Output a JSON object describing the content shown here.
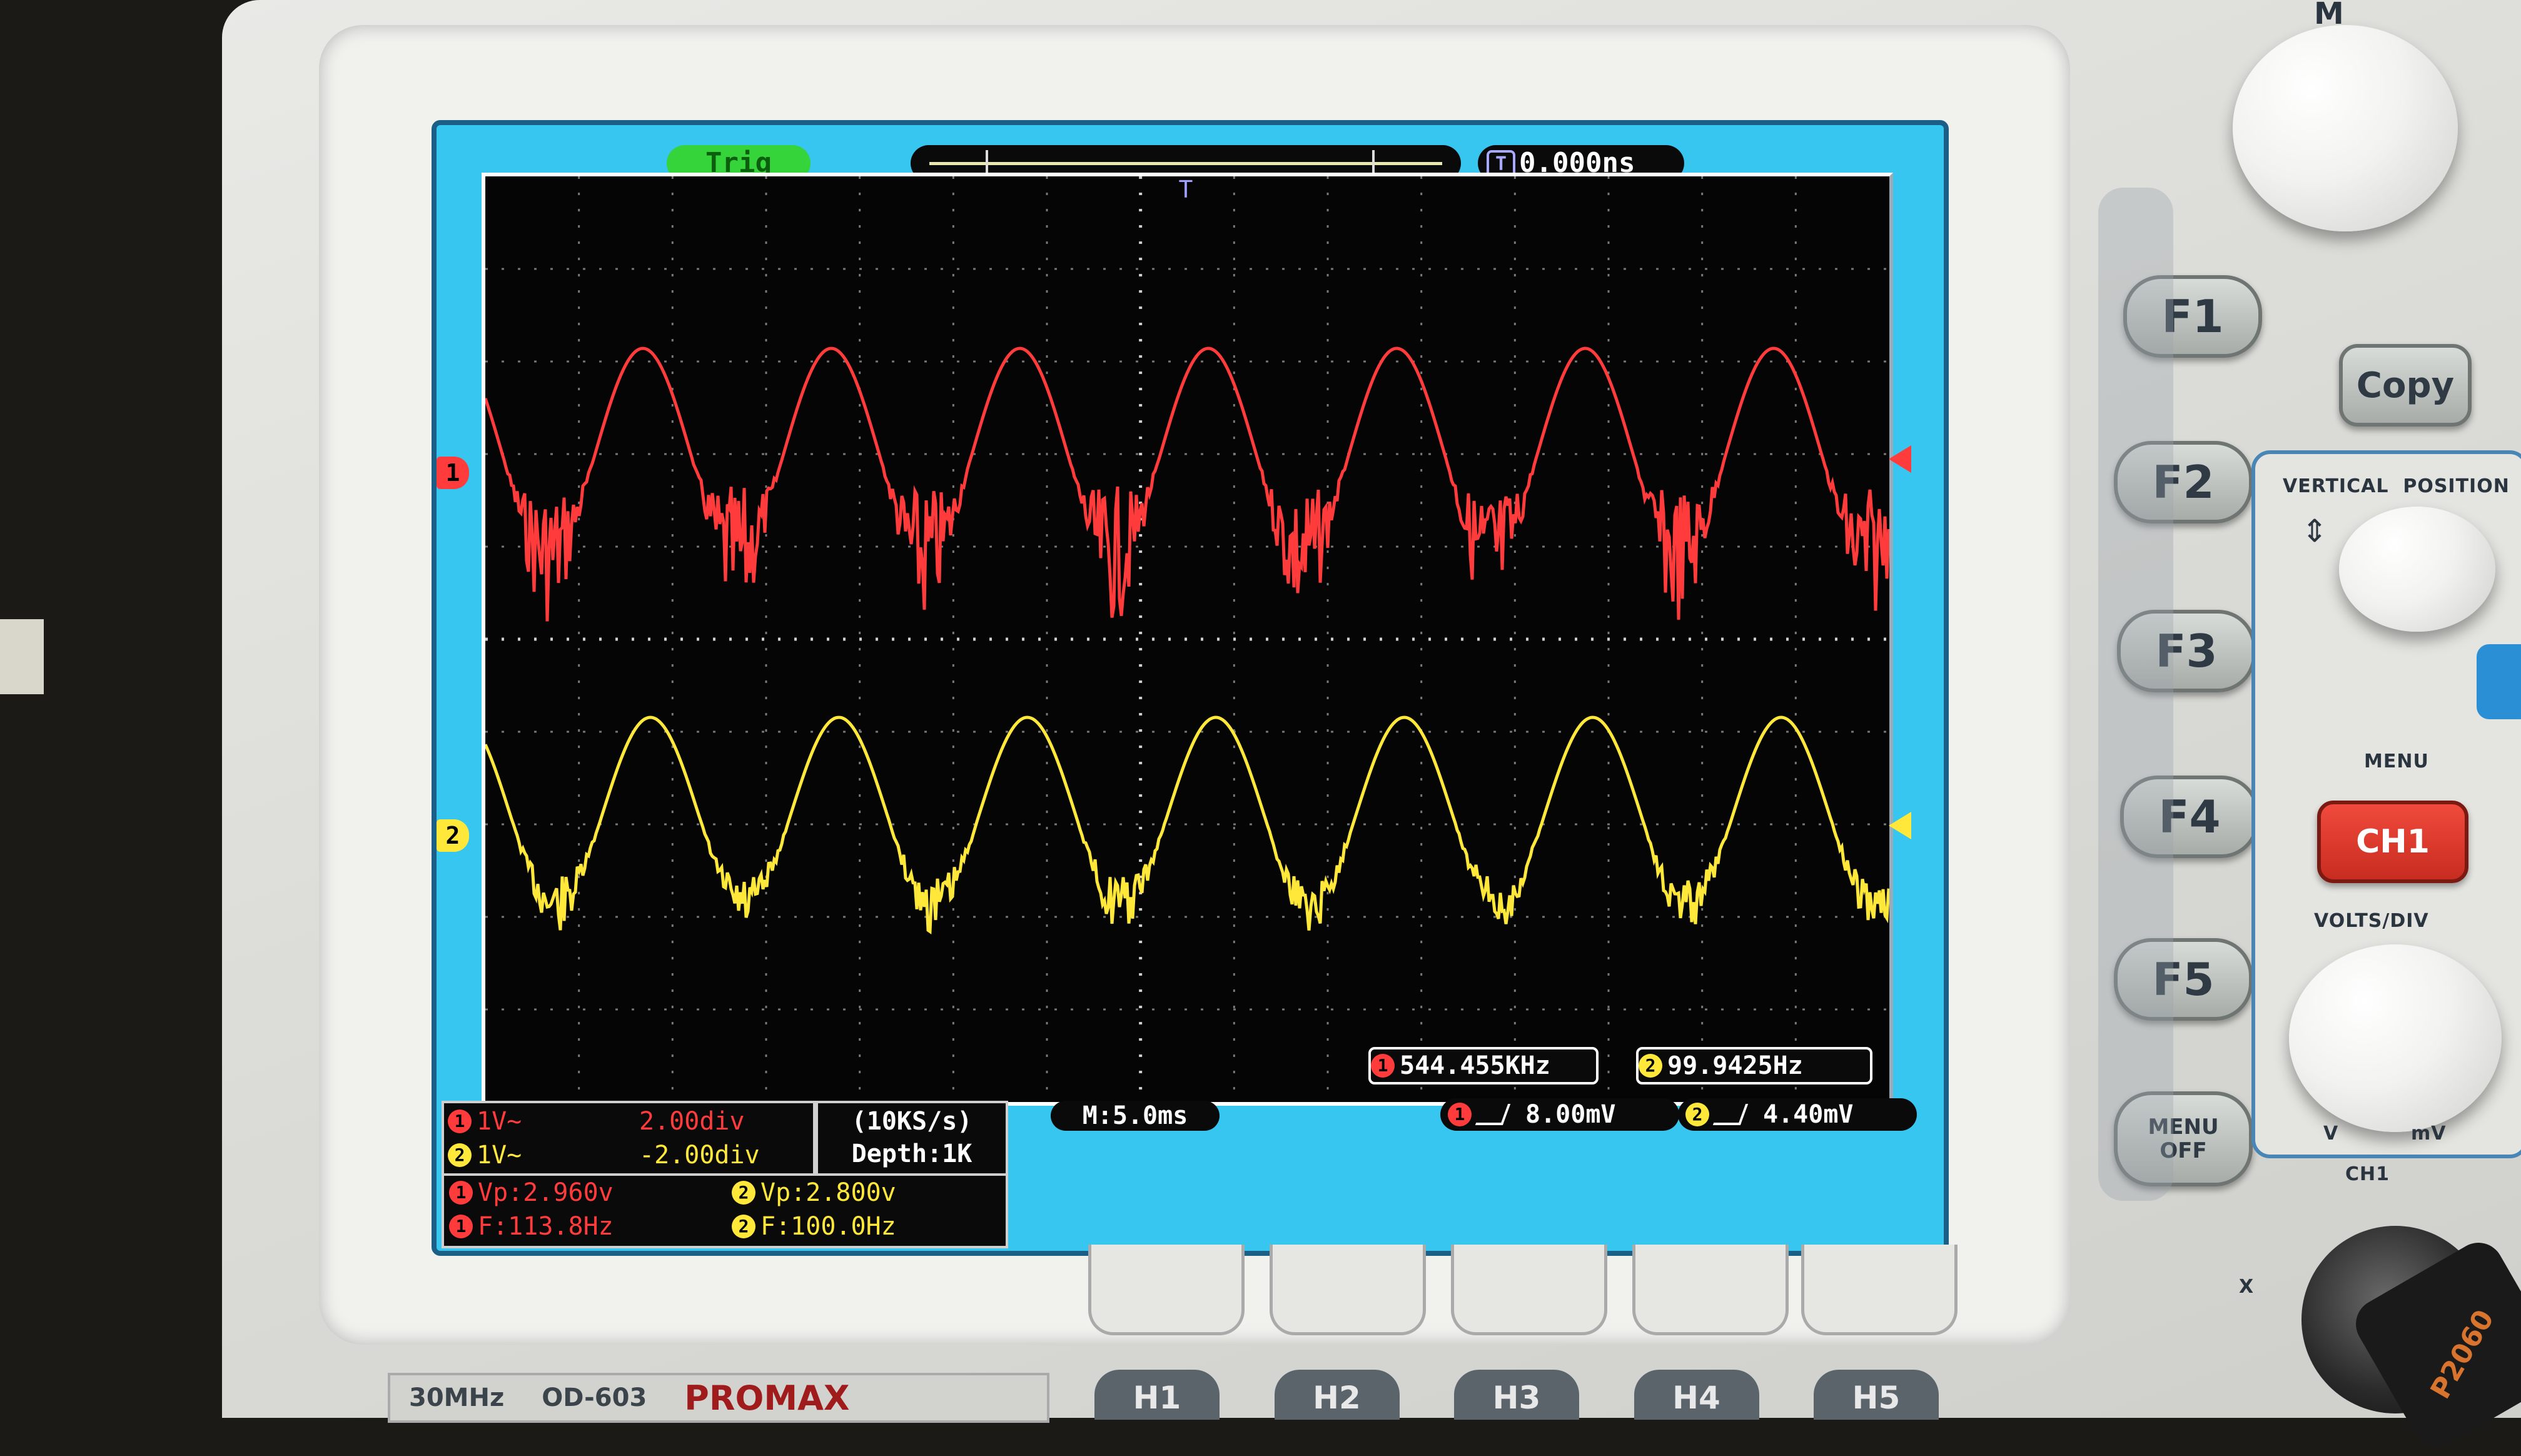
{
  "status_bar": {
    "trig": "Trig",
    "trigger_marker": "T",
    "time_offset": "0.000ns"
  },
  "channels": [
    {
      "id": "1",
      "color": "#ff3b3b",
      "coupling": "1V~",
      "position": "2.00div",
      "vp": "Vp:2.960v",
      "freq": "F:113.8Hz",
      "counter": "544.455KHz",
      "trigger_level": "8.00mV"
    },
    {
      "id": "2",
      "color": "#ffe83a",
      "coupling": "1V~",
      "position": "-2.00div",
      "vp": "Vp:2.800v",
      "freq": "F:100.0Hz",
      "counter": "99.9425Hz",
      "trigger_level": "4.40mV"
    }
  ],
  "acquisition": {
    "rate": "(10KS/s)",
    "depth": "Depth:1K",
    "timebase": "M:5.0ms"
  },
  "side_buttons": [
    "F1",
    "F2",
    "F3",
    "F4",
    "F5"
  ],
  "menu_off": [
    "MENU",
    "OFF"
  ],
  "panel": {
    "copy": "Copy",
    "m_label": "M",
    "vertical_position": "VERTICAL  POSITION",
    "menu": "MENU",
    "ch1_button": "CH1",
    "volts_div": "VOLTS/DIV",
    "v": "V",
    "mv": "mV",
    "ch1_input": "CH1",
    "x": "X",
    "probe_label": "P2060"
  },
  "brand": {
    "bandwidth": "30MHz",
    "model": "OD-603",
    "maker": "PROMAX"
  },
  "soft_keys": [
    "H1",
    "H2",
    "H3",
    "H4",
    "H5"
  ]
}
